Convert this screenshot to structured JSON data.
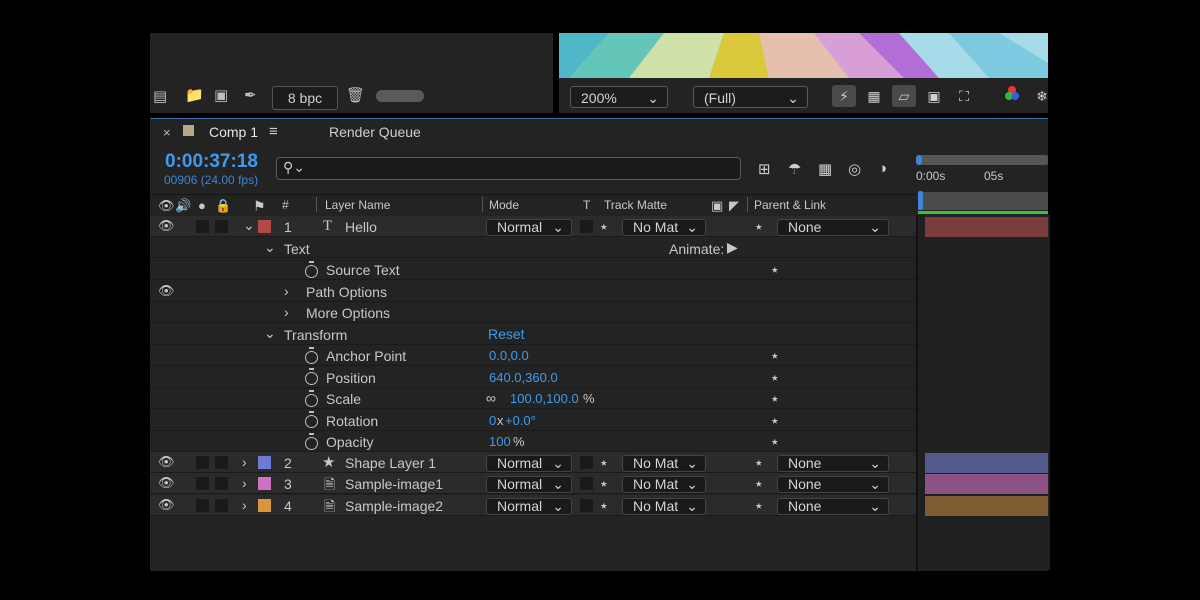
{
  "project_bar": {
    "bpc_label": "8 bpc",
    "icons": [
      "flowchart-icon",
      "folder-icon",
      "new-comp-icon",
      "pen-icon",
      "trash-icon"
    ]
  },
  "viewer": {
    "zoom": "200%",
    "resolution": "(Full)",
    "icons": [
      "fast-preview-icon",
      "transparency-grid-icon",
      "mask-path-icon",
      "region-icon",
      "grid-guides-icon",
      "channel-icon",
      "snapshot-icon"
    ]
  },
  "tabs": {
    "comp": "Comp 1",
    "render_queue": "Render Queue"
  },
  "timecode": "0:00:37:18",
  "frames": "00906 (24.00 fps)",
  "columns": {
    "num": "#",
    "layer_name": "Layer Name",
    "mode": "Mode",
    "t": "T",
    "track_matte": "Track Matte",
    "parent": "Parent & Link"
  },
  "ruler": {
    "t0": "0:00s",
    "t5": "05s"
  },
  "layers": [
    {
      "num": "1",
      "name": "Hello",
      "mode": "Normal",
      "matte": "No Mat",
      "parent": "None",
      "color": "#b34845",
      "bar": "#7a3c3c",
      "icon": "text-layer-icon"
    },
    {
      "num": "2",
      "name": "Shape Layer 1",
      "mode": "Normal",
      "matte": "No Mat",
      "parent": "None",
      "color": "#6d7bd6",
      "bar": "#535a8c",
      "icon": "star-icon"
    },
    {
      "num": "3",
      "name": "Sample-image1",
      "mode": "Normal",
      "matte": "No Mat",
      "parent": "None",
      "color": "#d071c5",
      "bar": "#8a5285",
      "icon": "file-icon"
    },
    {
      "num": "4",
      "name": "Sample-image2",
      "mode": "Normal",
      "matte": "No Mat",
      "parent": "None",
      "color": "#d9963c",
      "bar": "#7f5c34",
      "icon": "file-icon"
    }
  ],
  "props": {
    "text": "Text",
    "animate": "Animate:",
    "source_text": "Source Text",
    "path_options": "Path Options",
    "more_options": "More Options",
    "transform": "Transform",
    "reset": "Reset",
    "anchor_point": "Anchor Point",
    "anchor_value": "0.0,0.0",
    "position": "Position",
    "position_value": "640.0,360.0",
    "scale": "Scale",
    "scale_value": "100.0,100.0",
    "scale_unit": "%",
    "rotation": "Rotation",
    "rotation_turns": "0",
    "rotation_x": "x",
    "rotation_value": "+0.0°",
    "opacity": "Opacity",
    "opacity_value": "100",
    "opacity_unit": "%"
  }
}
